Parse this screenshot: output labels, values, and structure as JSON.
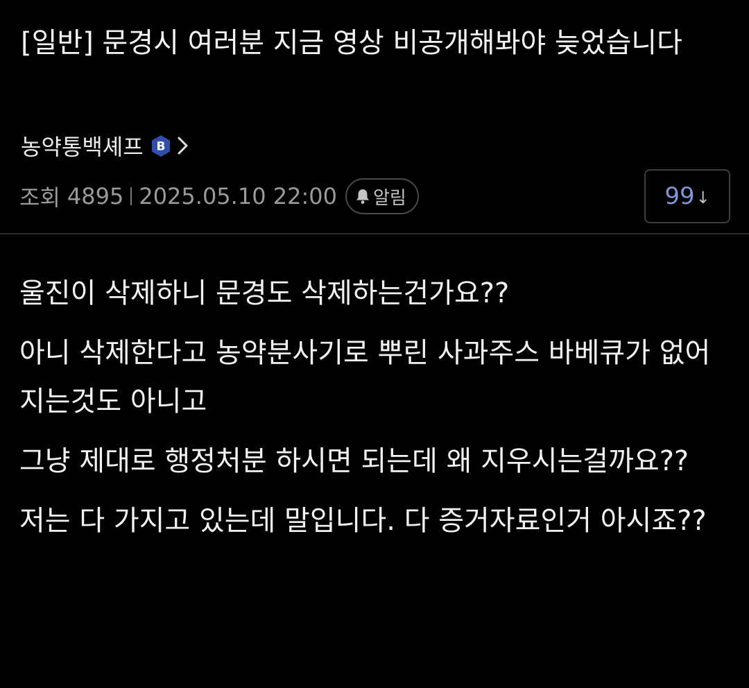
{
  "post": {
    "title": "[일반] 문경시 여러분 지금 영상 비공개해봐야 늦었습니다",
    "author": "농약통백셰프",
    "author_badge": "B",
    "views_label": "조회",
    "views": "4895",
    "datetime": "2025.05.10 22:00",
    "alarm_label": "알림",
    "comment_count": "99",
    "comment_arrow": "↓"
  },
  "content": {
    "paragraphs": [
      "울진이 삭제하니 문경도 삭제하는건가요??",
      "아니 삭제한다고 농약분사기로 뿌린 사과주스 바베큐가 없어지는것도 아니고",
      "그냥 제대로 행정처분 하시면 되는데 왜 지우시는걸까요??",
      "저는 다 가지고 있는데 말입니다. 다 증거자료인거 아시죠??"
    ]
  },
  "colors": {
    "background": "#000000",
    "text": "#f2f2f2",
    "meta": "#9a9a9a",
    "badge": "#2f4fa8",
    "comment_count": "#7f95d8"
  },
  "icons": [
    "badge-b-icon",
    "chevron-right-icon",
    "bell-icon",
    "arrow-down-icon"
  ]
}
